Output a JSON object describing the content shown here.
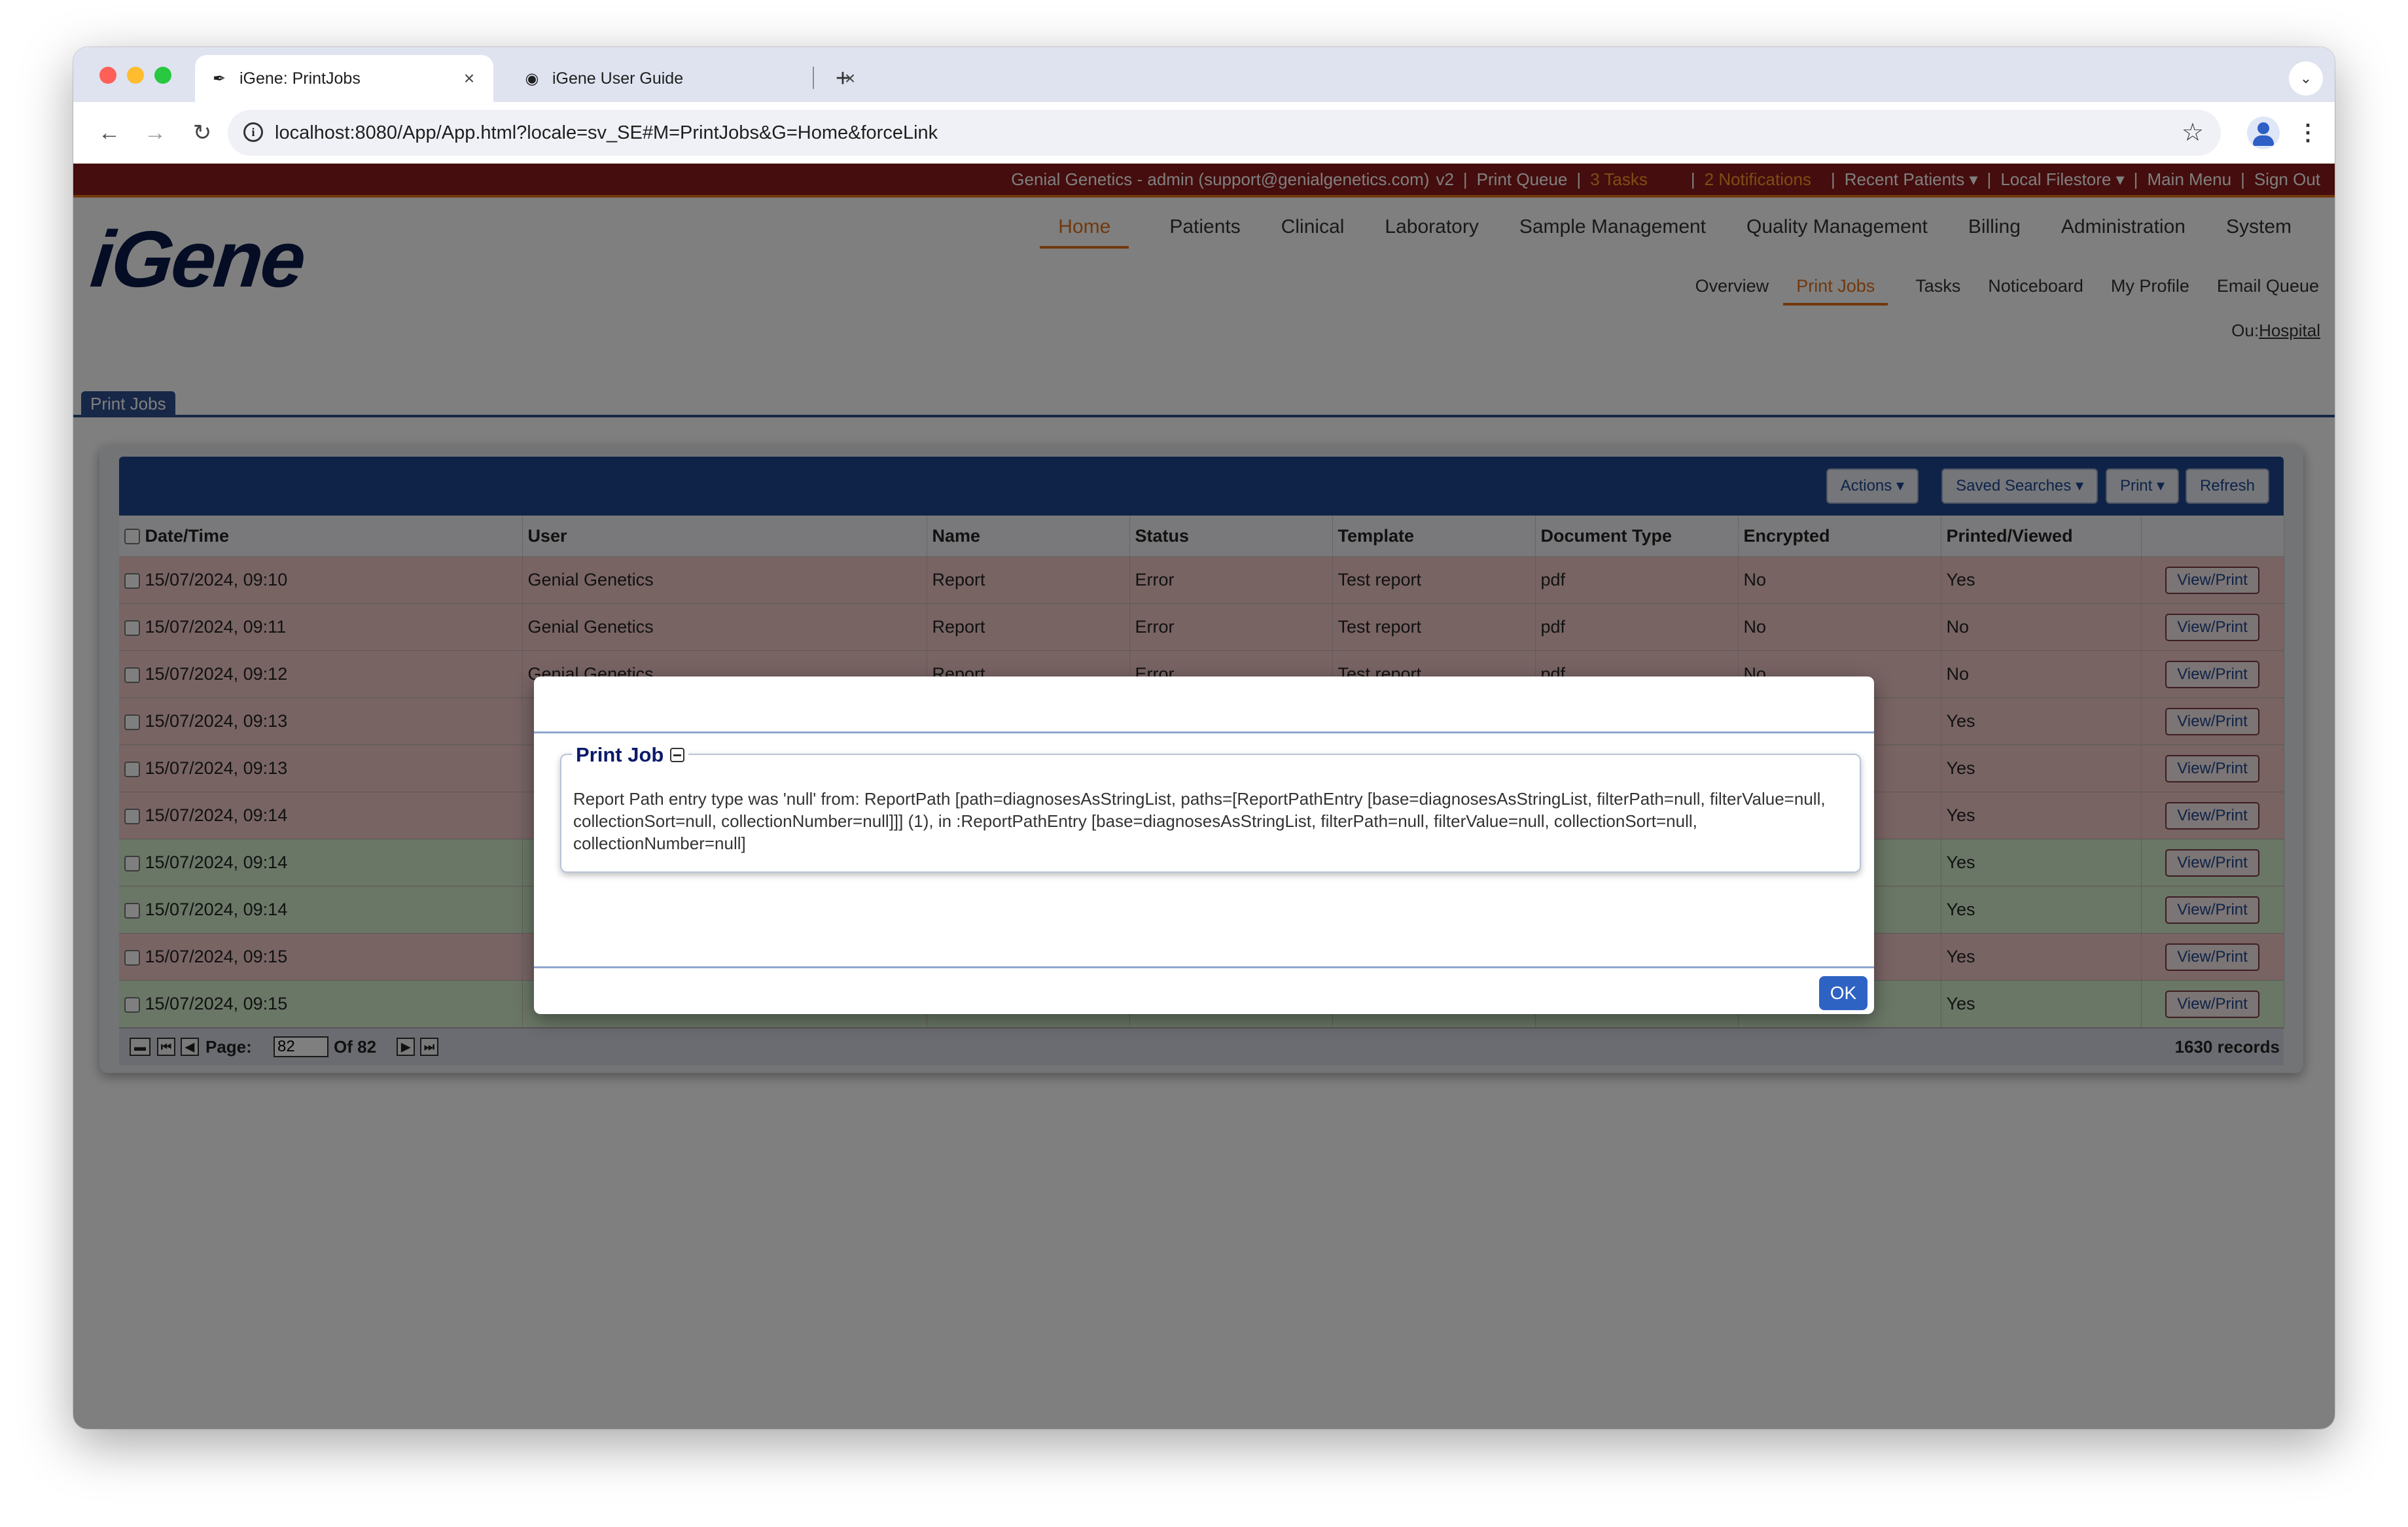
{
  "browser": {
    "tabs": [
      {
        "title": "iGene: PrintJobs",
        "active": true
      },
      {
        "title": "iGene User Guide",
        "active": false
      }
    ],
    "url": "localhost:8080/App/App.html?locale=sv_SE#M=PrintJobs&G=Home&forceLink"
  },
  "topbar": {
    "user": "Genial Genetics - admin (support@genialgenetics.com)",
    "version": "v2",
    "print_queue": "Print Queue",
    "tasks": "3 Tasks",
    "notifications": "2 Notifications",
    "recent_patients": "Recent Patients ▾",
    "local_filestore": "Local Filestore ▾",
    "main_menu": "Main Menu",
    "sign_out": "Sign Out"
  },
  "logo": "iGene",
  "main_nav": [
    "Home",
    "Patients",
    "Clinical",
    "Laboratory",
    "Sample Management",
    "Quality Management",
    "Billing",
    "Administration",
    "System"
  ],
  "sub_nav": [
    "Overview",
    "Print Jobs",
    "Tasks",
    "Noticeboard",
    "My Profile",
    "Email Queue"
  ],
  "ou": {
    "label": "Ou:",
    "value": "Hospital"
  },
  "page_tab": "Print Jobs",
  "toolbar": {
    "actions": "Actions ▾",
    "saved_searches": "Saved Searches ▾",
    "print": "Print ▾",
    "refresh": "Refresh"
  },
  "table": {
    "columns": [
      "Date/Time",
      "User",
      "Name",
      "Status",
      "Template",
      "Document Type",
      "Encrypted",
      "Printed/Viewed"
    ],
    "action_label": "View/Print",
    "rows": [
      {
        "datetime": "15/07/2024, 09:10",
        "user": "Genial Genetics",
        "name": "Report",
        "status": "Error",
        "template": "Test report",
        "doctype": "pdf",
        "encrypted": "No",
        "printed": "Yes",
        "state": "err"
      },
      {
        "datetime": "15/07/2024, 09:11",
        "user": "Genial Genetics",
        "name": "Report",
        "status": "Error",
        "template": "Test report",
        "doctype": "pdf",
        "encrypted": "No",
        "printed": "No",
        "state": "err"
      },
      {
        "datetime": "15/07/2024, 09:12",
        "user": "Genial Genetics",
        "name": "Report",
        "status": "Error",
        "template": "Test report",
        "doctype": "pdf",
        "encrypted": "No",
        "printed": "No",
        "state": "err"
      },
      {
        "datetime": "15/07/2024, 09:13",
        "user": "",
        "name": "",
        "status": "",
        "template": "",
        "doctype": "",
        "encrypted": "",
        "printed": "Yes",
        "state": "err"
      },
      {
        "datetime": "15/07/2024, 09:13",
        "user": "",
        "name": "",
        "status": "",
        "template": "",
        "doctype": "",
        "encrypted": "",
        "printed": "Yes",
        "state": "err"
      },
      {
        "datetime": "15/07/2024, 09:14",
        "user": "",
        "name": "",
        "status": "",
        "template": "",
        "doctype": "",
        "encrypted": "",
        "printed": "Yes",
        "state": "err"
      },
      {
        "datetime": "15/07/2024, 09:14",
        "user": "",
        "name": "",
        "status": "",
        "template": "",
        "doctype": "",
        "encrypted": "",
        "printed": "Yes",
        "state": "ok"
      },
      {
        "datetime": "15/07/2024, 09:14",
        "user": "",
        "name": "",
        "status": "",
        "template": "",
        "doctype": "",
        "encrypted": "",
        "printed": "Yes",
        "state": "ok"
      },
      {
        "datetime": "15/07/2024, 09:15",
        "user": "",
        "name": "",
        "status": "",
        "template": "",
        "doctype": "",
        "encrypted": "",
        "printed": "Yes",
        "state": "err"
      },
      {
        "datetime": "15/07/2024, 09:15",
        "user": "",
        "name": "",
        "status": "",
        "template": "",
        "doctype": "",
        "encrypted": "",
        "printed": "Yes",
        "state": "ok"
      }
    ]
  },
  "pager": {
    "page_label": "Page:",
    "page_value": "82",
    "of_label": "Of 82",
    "records": "1630 records"
  },
  "dialog": {
    "legend": "Print Job",
    "message": "Report Path entry type was 'null' from: ReportPath [path=diagnosesAsStringList, paths=[ReportPathEntry [base=diagnosesAsStringList, filterPath=null, filterValue=null, collectionSort=null, collectionNumber=null]]] (1), in :ReportPathEntry [base=diagnosesAsStringList, filterPath=null, filterValue=null, collectionSort=null, collectionNumber=null]",
    "ok": "OK"
  },
  "colors": {
    "topbar": "#8b1a1a",
    "accent": "#e2701a",
    "header_blue": "#1f4790",
    "error_row": "#f3c8c8",
    "ok_row": "#d4eecd",
    "ok_button": "#2e63c4"
  }
}
